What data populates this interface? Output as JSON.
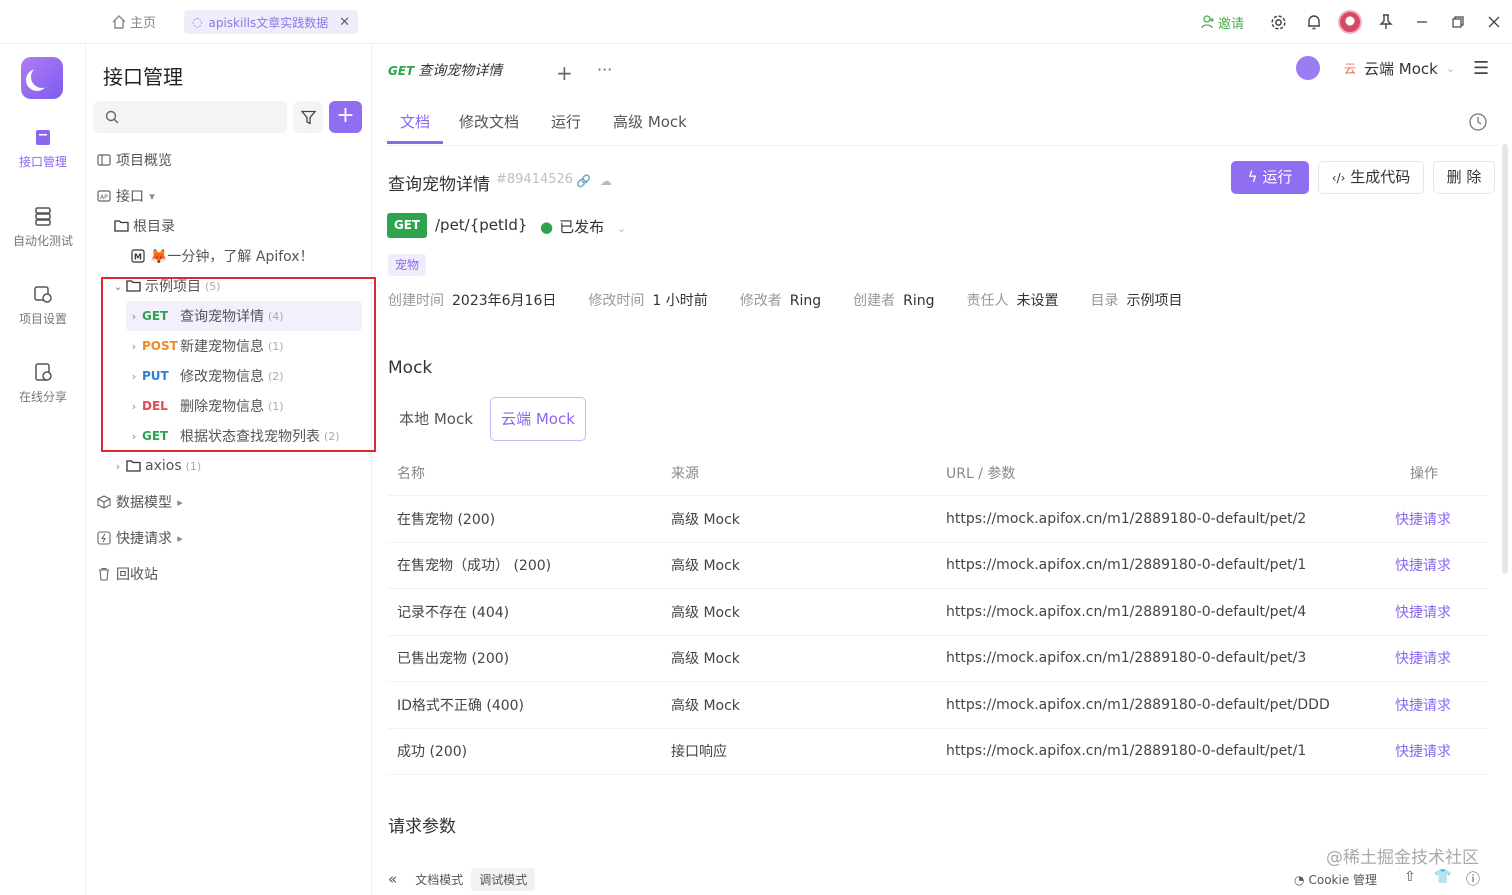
{
  "titlebar": {
    "home_label": "主页",
    "tab_label": "apiskills文章实践数据",
    "invite_label": "邀请"
  },
  "rail": {
    "items": [
      {
        "label": "接口管理",
        "icon": "api-icon",
        "active": true
      },
      {
        "label": "自动化测试",
        "icon": "automation-icon",
        "active": false
      },
      {
        "label": "项目设置",
        "icon": "settings-icon",
        "active": false
      },
      {
        "label": "在线分享",
        "icon": "share-icon",
        "active": false
      }
    ]
  },
  "tree": {
    "title": "接口管理",
    "overview": "项目概览",
    "api_root": "接口",
    "root_dir": "根目录",
    "intro_doc": "🦊一分钟，了解 Apifox！",
    "example_folder": {
      "label": "示例项目",
      "count": "(5)"
    },
    "endpoints": [
      {
        "method": "GET",
        "label": "查询宠物详情",
        "count": "(4)"
      },
      {
        "method": "POST",
        "label": "新建宠物信息",
        "count": "(1)"
      },
      {
        "method": "PUT",
        "label": "修改宠物信息",
        "count": "(2)"
      },
      {
        "method": "DEL",
        "label": "删除宠物信息",
        "count": "(1)"
      },
      {
        "method": "GET",
        "label": "根据状态查找宠物列表",
        "count": "(2)"
      }
    ],
    "axios_folder": {
      "label": "axios",
      "count": "(1)"
    },
    "data_model": "数据模型",
    "quick_request": "快捷请求",
    "recycle_bin": "回收站"
  },
  "main": {
    "doc_tab": {
      "method": "GET",
      "label": "查询宠物详情"
    },
    "env_label": "云端 Mock",
    "env_prefix": "云",
    "subtabs": [
      "文档",
      "修改文档",
      "运行",
      "高级 Mock"
    ],
    "api_name": "查询宠物详情",
    "api_id": "#89414526",
    "run_label": "运行",
    "gen_code_label": "生成代码",
    "delete_label": "删 除",
    "method": "GET",
    "path": "/pet/{petId}",
    "status": "已发布",
    "tag": "宠物",
    "meta": [
      {
        "k": "创建时间",
        "v": "2023年6月16日"
      },
      {
        "k": "修改时间",
        "v": "1 小时前"
      },
      {
        "k": "修改者",
        "v": "Ring"
      },
      {
        "k": "创建者",
        "v": "Ring"
      },
      {
        "k": "责任人",
        "v": "未设置"
      },
      {
        "k": "目录",
        "v": "示例项目"
      }
    ],
    "mock_title": "Mock",
    "mock_tabs": [
      "本地 Mock",
      "云端 Mock"
    ],
    "table_headers": [
      "名称",
      "来源",
      "URL / 参数",
      "操作"
    ],
    "rows": [
      {
        "name": "在售宠物 (200)",
        "source": "高级 Mock",
        "url": "https://mock.apifox.cn/m1/2889180-0-default/pet/2",
        "action": "快捷请求"
      },
      {
        "name": "在售宠物（成功） (200)",
        "source": "高级 Mock",
        "url": "https://mock.apifox.cn/m1/2889180-0-default/pet/1",
        "action": "快捷请求"
      },
      {
        "name": "记录不存在 (404)",
        "source": "高级 Mock",
        "url": "https://mock.apifox.cn/m1/2889180-0-default/pet/4",
        "action": "快捷请求"
      },
      {
        "name": "已售出宠物 (200)",
        "source": "高级 Mock",
        "url": "https://mock.apifox.cn/m1/2889180-0-default/pet/3",
        "action": "快捷请求"
      },
      {
        "name": "ID格式不正确 (400)",
        "source": "高级 Mock",
        "url": "https://mock.apifox.cn/m1/2889180-0-default/pet/DDD",
        "action": "快捷请求"
      },
      {
        "name": "成功 (200)",
        "source": "接口响应",
        "url": "https://mock.apifox.cn/m1/2889180-0-default/pet/1",
        "action": "快捷请求"
      }
    ],
    "request_params_title": "请求参数"
  },
  "bottom": {
    "doc_mode": "文档模式",
    "debug_mode": "调试模式",
    "cookie": "Cookie 管理",
    "watermark": "@稀土掘金技术社区"
  }
}
